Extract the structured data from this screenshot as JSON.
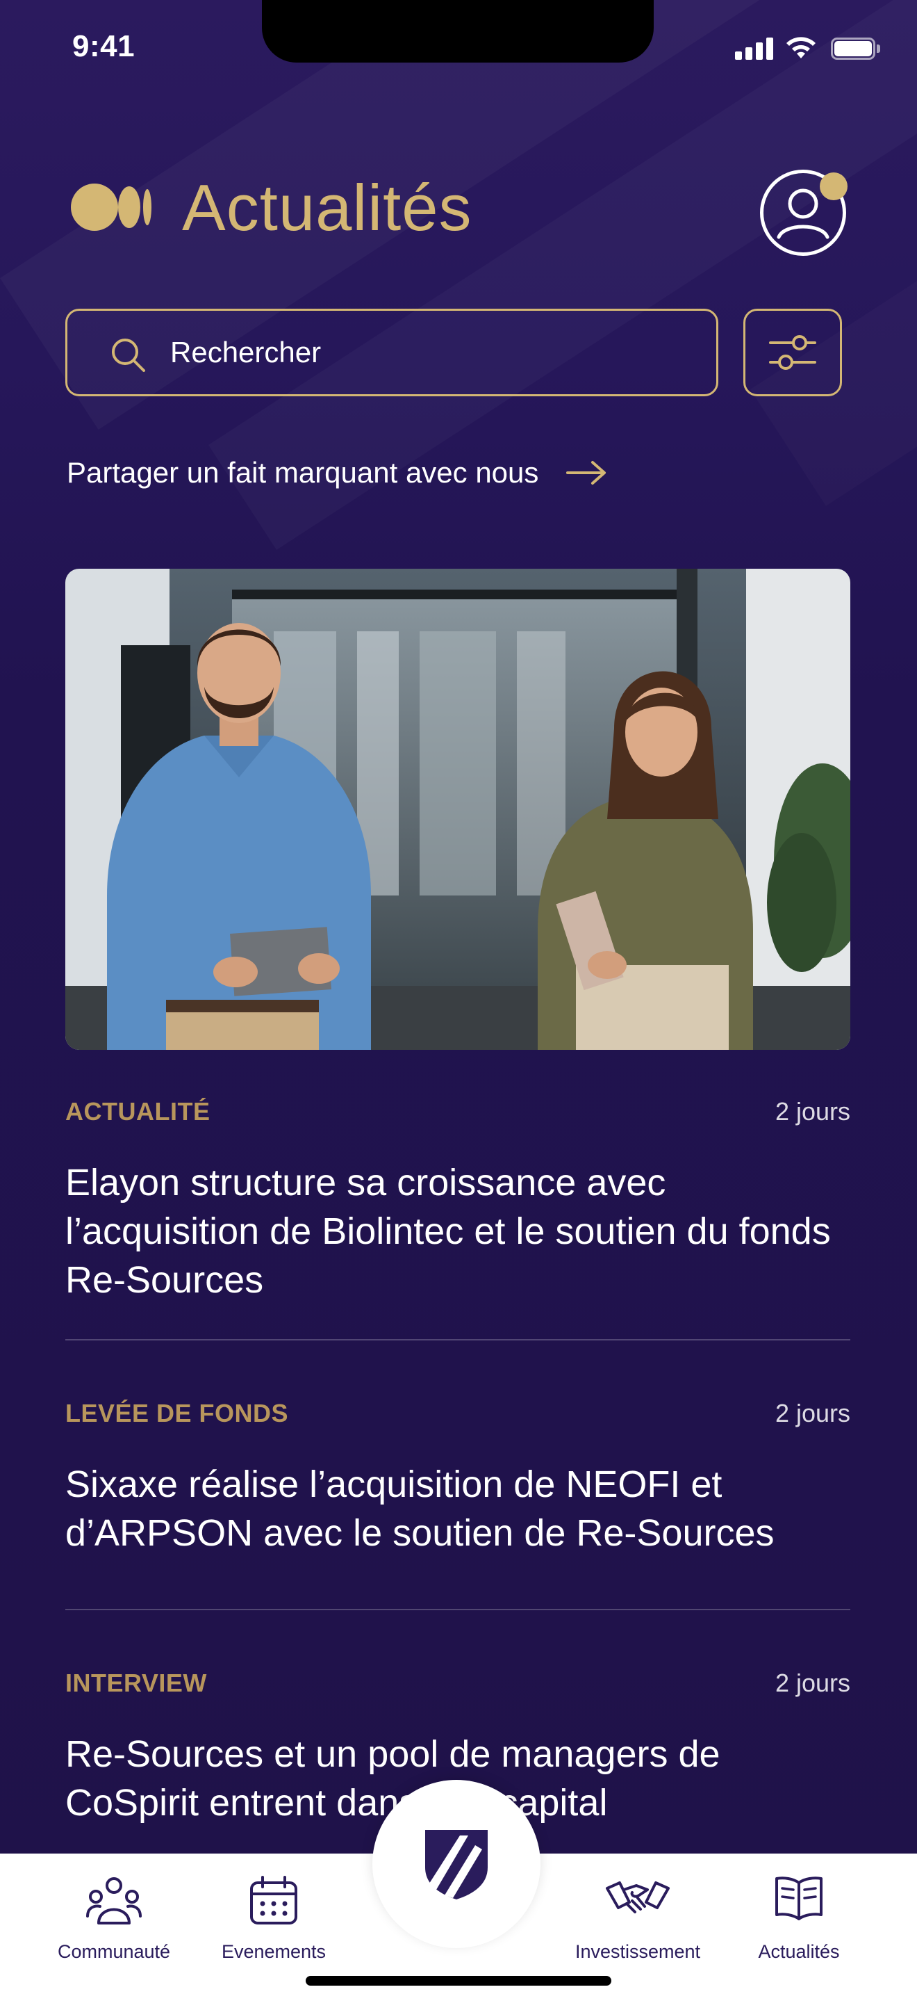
{
  "status_bar": {
    "time": "9:41"
  },
  "header": {
    "title": "Actualités"
  },
  "search": {
    "placeholder": "Rechercher"
  },
  "share": {
    "label": "Partager un fait marquant avec nous"
  },
  "hero": {
    "icon": "team-photo"
  },
  "news": [
    {
      "category": "ACTUALITÉ",
      "time": "2 jours",
      "title": "Elayon structure sa croissance avec l’acquisition de Biolintec et le soutien du fonds Re-Sources"
    },
    {
      "category": "LEVÉE DE FONDS",
      "time": "2 jours",
      "title": "Sixaxe réalise l’acquisition de NEOFI et d’ARPSON avec le soutien de Re-Sources"
    },
    {
      "category": "INTERVIEW",
      "time": "2 jours",
      "title": "Re-Sources et un pool de managers de CoSpirit entrent dans son capital"
    }
  ],
  "bottom_nav": {
    "items": [
      {
        "label": "Communauté",
        "icon": "community-icon"
      },
      {
        "label": "Evenements",
        "icon": "calendar-icon"
      },
      {
        "label": "Investissement",
        "icon": "handshake-icon"
      },
      {
        "label": "Actualités",
        "icon": "book-icon"
      }
    ]
  },
  "colors": {
    "background": "#24154f",
    "accent_gold": "#d4b774",
    "category_gold": "#b8965c",
    "nav_background": "#ffffff",
    "nav_text": "#2a1c5c"
  }
}
